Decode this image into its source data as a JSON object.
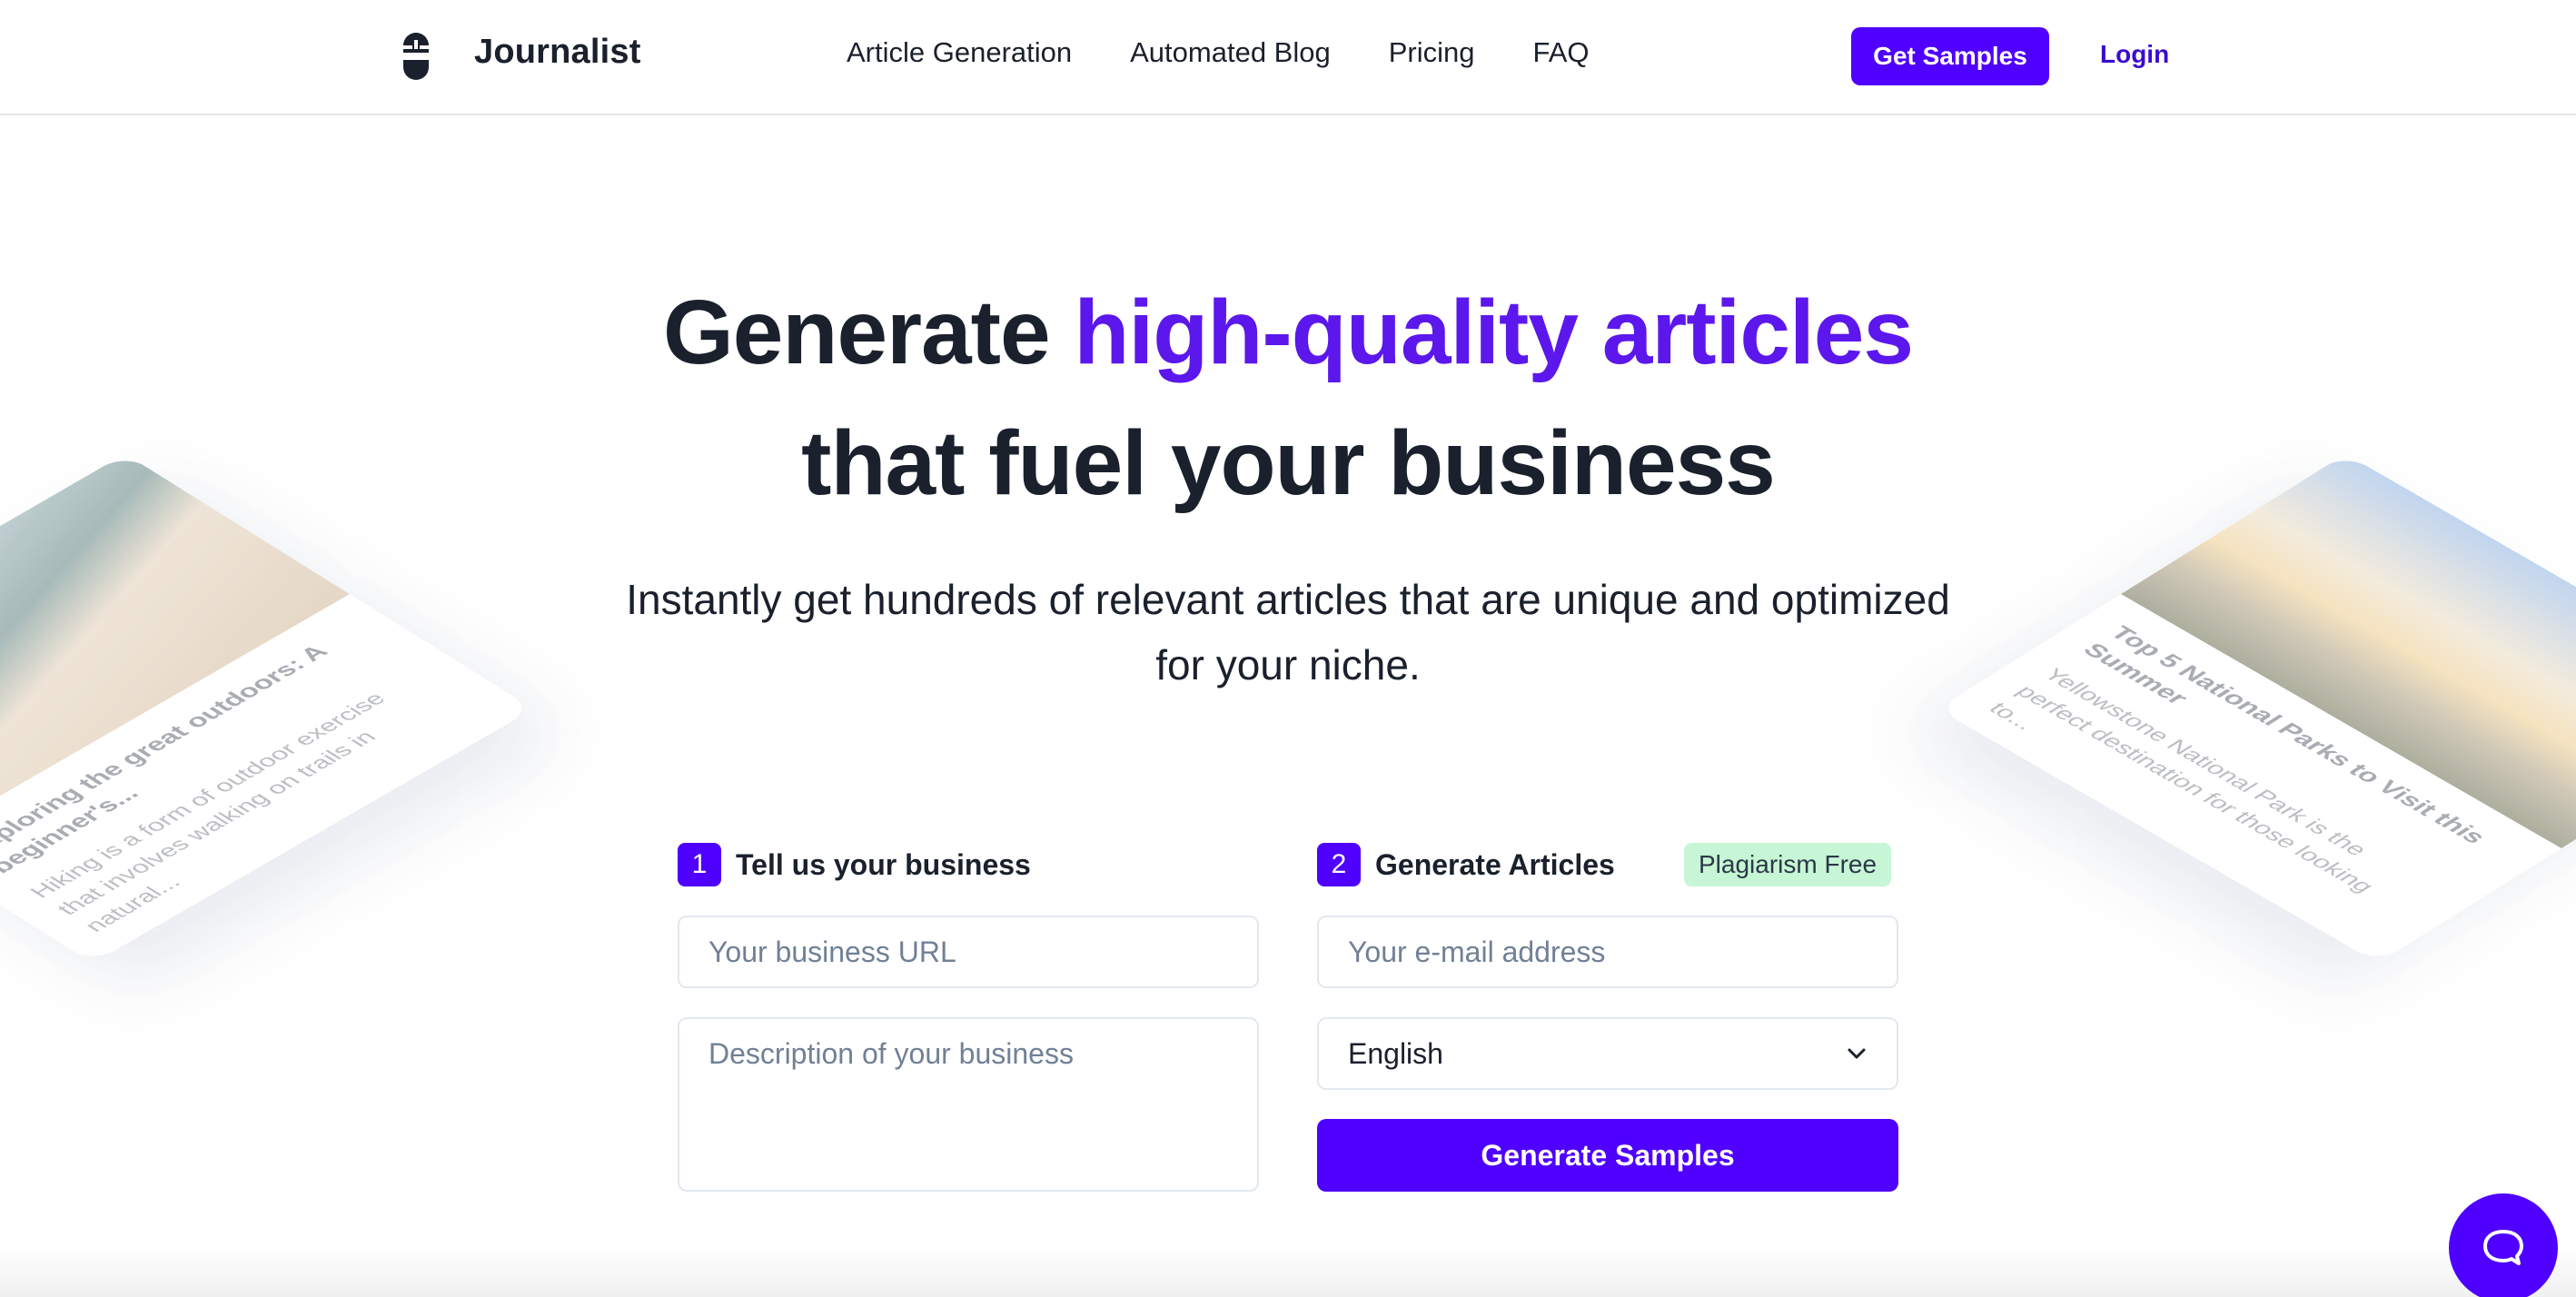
{
  "header": {
    "brand": "Journalist",
    "nav": [
      "Article Generation",
      "Automated Blog",
      "Pricing",
      "FAQ"
    ],
    "cta_label": "Get Samples",
    "login_label": "Login"
  },
  "hero": {
    "title_prefix": "Generate ",
    "title_accent": "high-quality articles",
    "title_line2": "that fuel your business",
    "subtitle": "Instantly get hundreds of relevant articles that are unique and optimized for your niche."
  },
  "form": {
    "step1": {
      "number": "1",
      "label": "Tell us your business"
    },
    "step2": {
      "number": "2",
      "label": "Generate Articles"
    },
    "badge": "Plagiarism Free",
    "url_placeholder": "Your business URL",
    "description_placeholder": "Description of your business",
    "email_placeholder": "Your e-mail address",
    "language_selected": "English",
    "submit_label": "Generate Samples"
  },
  "cards": [
    {
      "title": "Exploring the great outdoors: A beginner's...",
      "text": "Hiking is a form of outdoor exercise that involves walking on trails in natural..."
    },
    {
      "title": "Top 5 National Parks to Visit this Summer",
      "text": "Yellowstone National Park is the perfect destination for those looking to..."
    }
  ],
  "colors": {
    "accent": "#4f00ff",
    "accent_text": "#5b17ec",
    "badge_bg": "#c6f6d5",
    "text_dark": "#1a202c"
  }
}
